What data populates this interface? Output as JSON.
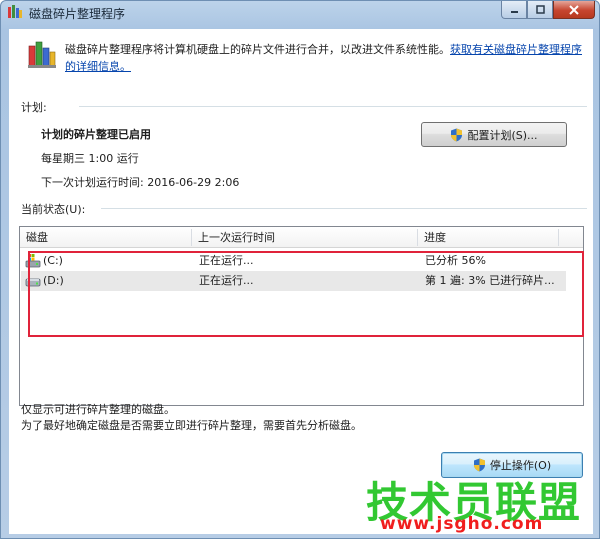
{
  "window": {
    "title": "磁盘碎片整理程序"
  },
  "intro": {
    "text": "磁盘碎片整理程序将计算机硬盘上的碎片文件进行合并，以改进文件系统性能。",
    "link": "获取有关磁盘碎片整理程序的详细信息。"
  },
  "schedule": {
    "section_label": "计划:",
    "status": "计划的碎片整理已启用",
    "frequency": "每星期三  1:00 运行",
    "next_run": "下一次计划运行时间: 2016-06-29 2:06",
    "configure_button": "配置计划(S)..."
  },
  "current_status": {
    "section_label": "当前状态(U):",
    "columns": [
      "磁盘",
      "上一次运行时间",
      "进度"
    ],
    "rows": [
      {
        "disk": "(C:)",
        "last_run": "正在运行...",
        "progress": "已分析 56%",
        "icon": "system-drive-icon"
      },
      {
        "disk": "(D:)",
        "last_run": "正在运行...",
        "progress": "第 1 遍: 3% 已进行碎片...",
        "icon": "drive-icon"
      }
    ]
  },
  "footer": {
    "line1": "仅显示可进行碎片整理的磁盘。",
    "line2": "为了最好地确定磁盘是否需要立即进行碎片整理，需要首先分析磁盘。",
    "stop_button": "停止操作(O)"
  },
  "watermark": {
    "text": "技术员联盟",
    "url": "www.jsgho.com"
  },
  "colors": {
    "highlight": "#e0233a",
    "link": "#0645ad",
    "watermark_green": "#32c832",
    "watermark_red": "#f01e1e"
  }
}
